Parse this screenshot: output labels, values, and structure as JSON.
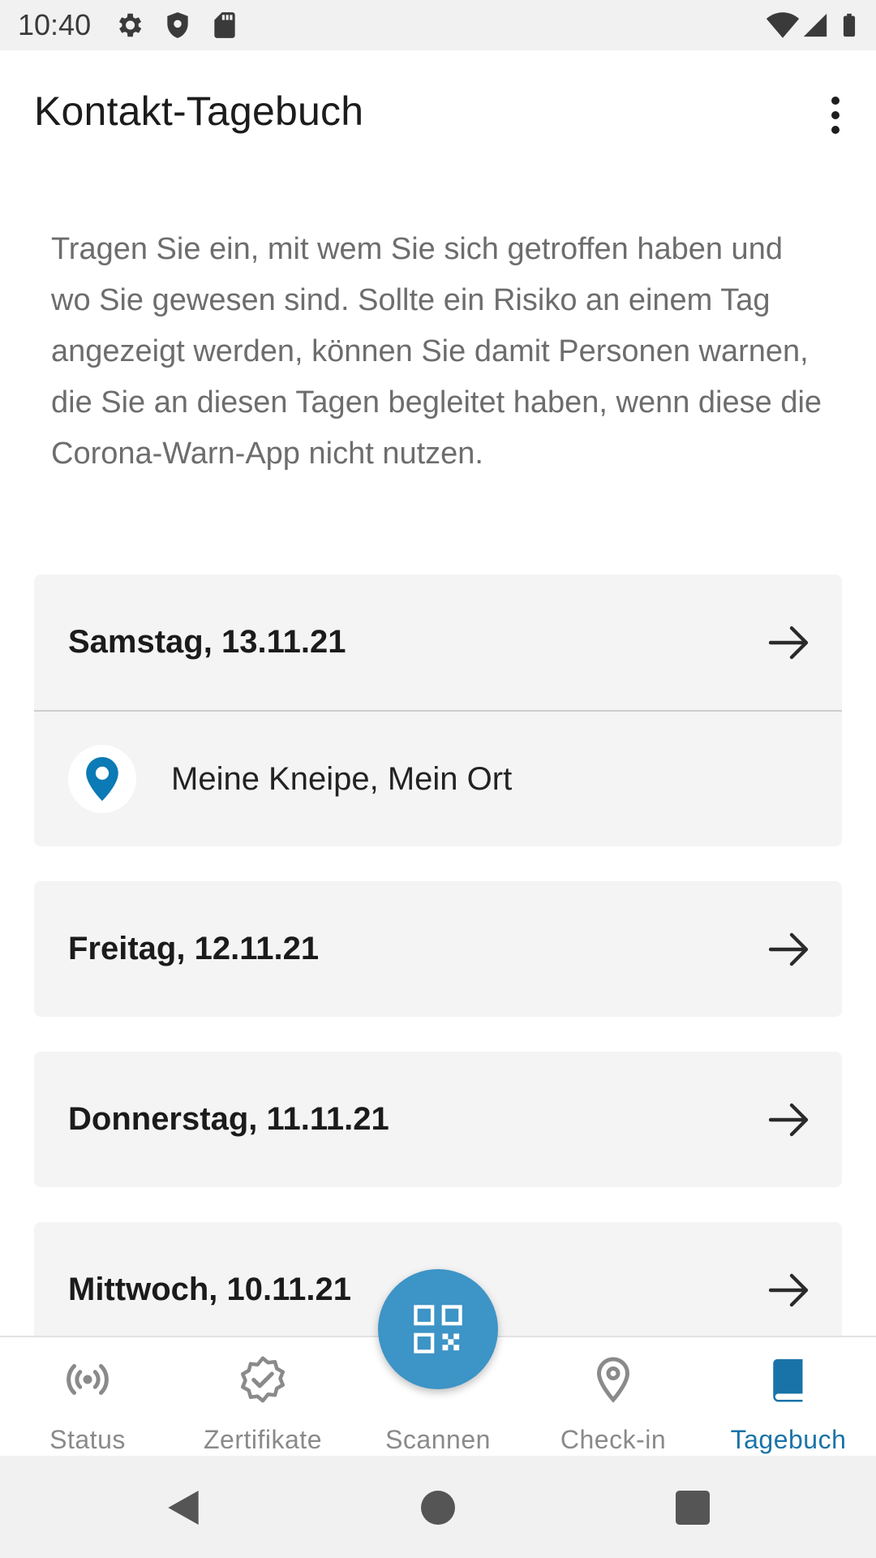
{
  "status_bar": {
    "time": "10:40",
    "left_icons": [
      "gear-icon",
      "shield-icon",
      "sd-card-icon"
    ],
    "right_icons": [
      "wifi-icon",
      "cell-signal-icon",
      "battery-icon"
    ]
  },
  "app_bar": {
    "title": "Kontakt-Tagebuch",
    "overflow_icon": "more-vert-icon"
  },
  "intro": "Tragen Sie ein, mit wem Sie sich getroffen haben und wo Sie gewesen sind. Sollte ein Risiko an einem Tag angezeigt werden, können Sie damit Personen warnen, die Sie an diesen Tagen begleitet haben, wenn diese die Corona-Warn-App nicht nutzen.",
  "days": [
    {
      "date": "Samstag, 13.11.21",
      "entries": [
        {
          "icon": "location-pin-icon",
          "label": "Meine Kneipe, Mein Ort"
        }
      ]
    },
    {
      "date": "Freitag, 12.11.21",
      "entries": []
    },
    {
      "date": "Donnerstag, 11.11.21",
      "entries": []
    },
    {
      "date": "Mittwoch, 10.11.21",
      "entries": []
    }
  ],
  "bottom_nav": {
    "items": [
      {
        "label": "Status",
        "icon": "broadcast-icon",
        "active": false
      },
      {
        "label": "Zertifikate",
        "icon": "certificate-badge-icon",
        "active": false
      },
      {
        "label": "Scannen",
        "icon": "qr-code-icon",
        "active": false
      },
      {
        "label": "Check-in",
        "icon": "location-pin-icon",
        "active": false
      },
      {
        "label": "Tagebuch",
        "icon": "book-icon",
        "active": true
      }
    ]
  },
  "colors": {
    "accent": "#1a73a8",
    "fab": "#3d94c6",
    "pin": "#0b7ab5",
    "card_bg": "#f4f4f4",
    "inactive": "#8a8a8a"
  }
}
